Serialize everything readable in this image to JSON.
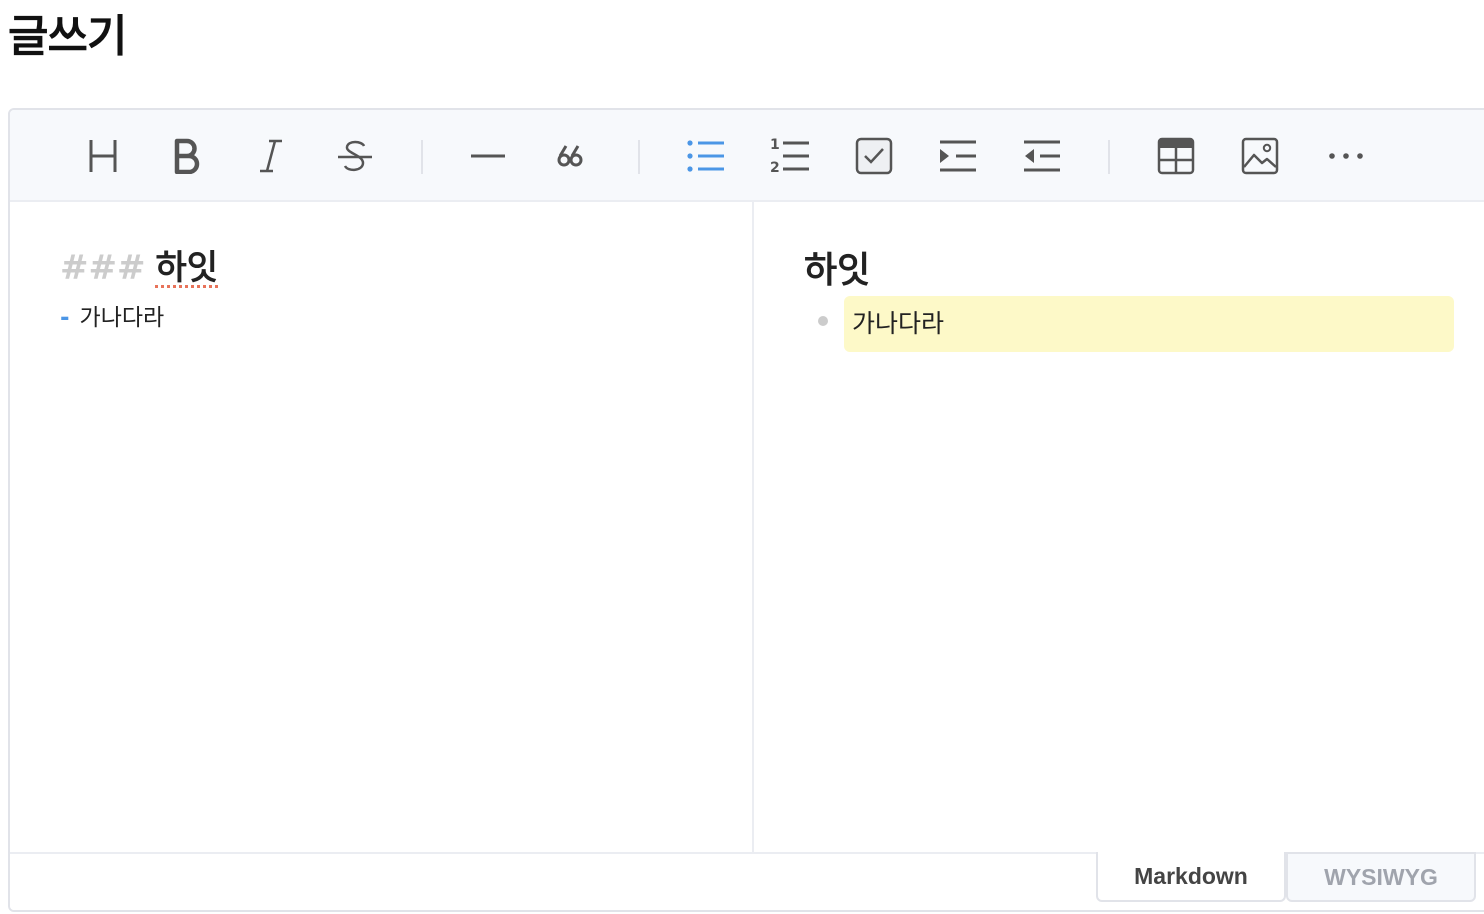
{
  "page": {
    "title": "글쓰기"
  },
  "toolbar": {
    "items": [
      {
        "name": "heading",
        "icon": "heading-icon",
        "label": "H"
      },
      {
        "name": "bold",
        "icon": "bold-icon",
        "label": "B"
      },
      {
        "name": "italic",
        "icon": "italic-icon",
        "label": "I"
      },
      {
        "name": "strike",
        "icon": "strike-icon",
        "label": "S"
      },
      {
        "name": "hr",
        "icon": "horizontal-rule-icon"
      },
      {
        "name": "quote",
        "icon": "quote-icon",
        "label": "66"
      },
      {
        "name": "bullet-list",
        "icon": "bullet-list-icon",
        "active": true
      },
      {
        "name": "ordered-list",
        "icon": "ordered-list-icon"
      },
      {
        "name": "task-list",
        "icon": "task-list-icon"
      },
      {
        "name": "indent",
        "icon": "indent-icon"
      },
      {
        "name": "outdent",
        "icon": "outdent-icon"
      },
      {
        "name": "table",
        "icon": "table-icon"
      },
      {
        "name": "image",
        "icon": "image-icon"
      },
      {
        "name": "more",
        "icon": "more-icon",
        "label": "···"
      }
    ]
  },
  "markdown": {
    "heading_marker": "###",
    "heading_text": "하잇",
    "list_marker": "-",
    "list_text": "가나다라"
  },
  "preview": {
    "heading": "하잇",
    "list_items": [
      "가나다라"
    ]
  },
  "mode_tabs": {
    "markdown": "Markdown",
    "wysiwyg": "WYSIWYG",
    "active": "markdown"
  },
  "colors": {
    "accent": "#4b96e6",
    "icon": "#555555",
    "highlight": "#fdf9c8",
    "toolbar_bg": "#f7f9fc",
    "border": "#e1e3e9"
  }
}
